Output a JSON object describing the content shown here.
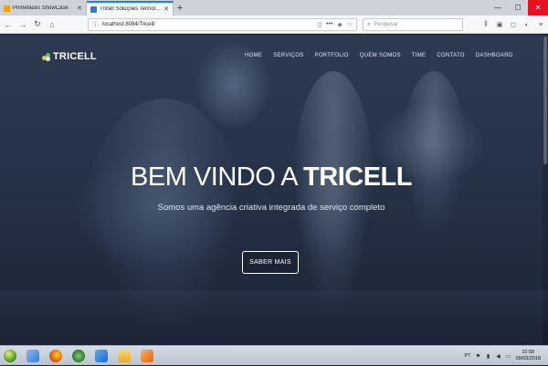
{
  "browser": {
    "tabs": [
      {
        "label": "Primefaces ShowCase",
        "icon_color": "#f0a30a"
      },
      {
        "label": "Tricell Soluções Tecnologicas",
        "icon_color": "#2e7bd6"
      }
    ],
    "new_tab_label": "+",
    "url": "localhost:8084/Tricell/",
    "search_placeholder": "Pesquisar"
  },
  "site": {
    "logo_text": "TRICELL",
    "logo_colors": [
      "#c9d93a",
      "#6cc04a",
      "#ffffff"
    ],
    "nav": [
      "HOME",
      "SERVIÇOS",
      "PORTFOLIO",
      "QUEM SOMOS",
      "TIME",
      "CONTATO",
      "DASHBOARD"
    ],
    "hero_title_prefix": "BEM VINDO A ",
    "hero_title_strong": "TRICELL",
    "hero_subtitle": "Somos uma agência criativa integrada de serviço completo",
    "hero_button": "SABER MAIS"
  },
  "taskbar": {
    "apps": [
      {
        "name": "explorer-app",
        "color": "#3a7bd5"
      },
      {
        "name": "firefox-app",
        "color": "#e66000"
      },
      {
        "name": "chrome-app",
        "color": "#34a853"
      },
      {
        "name": "netbeans-app",
        "color": "#1b6ac9"
      },
      {
        "name": "files-app",
        "color": "#e8c14a"
      },
      {
        "name": "media-app",
        "color": "#f08a24"
      }
    ],
    "language": "PT",
    "time": "10:58",
    "date": "09/03/2018"
  }
}
